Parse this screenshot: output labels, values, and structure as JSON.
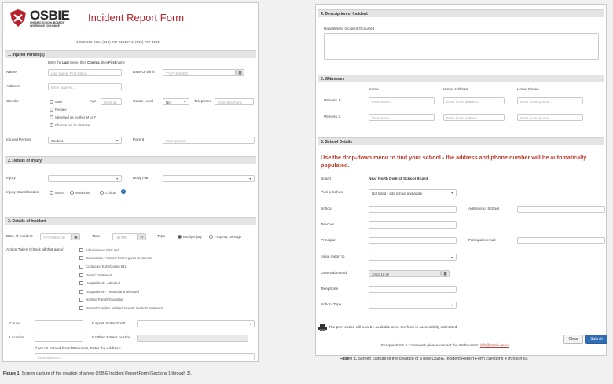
{
  "logo": {
    "name": "OSBIE",
    "line1": "ONTARIO SCHOOL BOARDS'",
    "line2": "INSURANCE EXCHANGE"
  },
  "form_title": "Incident Report Form",
  "contacts": "1-800-668-6724   (519) 767-2182   FAX (519) 767-0281",
  "s1": {
    "title": "1. Injured Person(s)",
    "hint_pre": "Enter the ",
    "hint_last": "Last",
    "hint_mid": " name, then ",
    "hint_comma": "Comma",
    "hint_then": ", then ",
    "hint_first": "First",
    "hint_end": " name",
    "name_label": "Name",
    "name_ph": "Last Name, First Name...",
    "dob_label": "Date Of Birth",
    "dob_ph": "YYYY-MM-DD",
    "address_label": "Address",
    "address_ph": "Enter address...",
    "gender_label": "Gender",
    "gender_options": [
      "Male",
      "Female",
      "Identified as neither M or F",
      "Choose not to disclose"
    ],
    "age_label": "Age",
    "age_ph": "Enter ag",
    "grade_label": "Grade Level",
    "grade_value": "N/A",
    "telephone_label": "Telephone",
    "telephone_ph": "Enter telephone",
    "injured_label": "Injured Person",
    "injured_value": "Student",
    "parent_label": "Parent",
    "parent_ph": "Enter parent..."
  },
  "s2": {
    "title": "2. Details of Injury",
    "injury_label": "Injury",
    "bodypart_label": "Body Part",
    "class_label": "Injury Classification",
    "class_options": [
      "Minor",
      "Moderate",
      "Critical"
    ]
  },
  "s3": {
    "title": "3. Details of Incident",
    "date_label": "Date of Incident",
    "date_ph": "YYYY-MM-DD",
    "time_label": "Time",
    "time_ph": "HH:MM",
    "type_label": "Type",
    "type_options": [
      "Bodily Injury",
      "Property Damage"
    ],
    "action_label": "Action Taken (Check all that apply)",
    "actions": [
      "Administered First Aid",
      "Concussion Protocol Forms given to parents",
      "Contacted EMS/Called 911",
      "Dental Treatment",
      "Hospitalized - Admitted",
      "Hospitalized - Treated and released",
      "Notified Parent/Guardian",
      "Parent/Guardian advised to seek medical treatment"
    ],
    "cause_label": "Cause",
    "sport_label": "If Sport, Enter Sport",
    "location_label": "Location",
    "other_label": "If Other, Enter Location",
    "premises_label": "If not on School board Premises, Enter the Address:",
    "premises_ph": "Enter address..."
  },
  "caption1_bold": "Figure 1.",
  "caption1": " Screen capture of the creation of a new OSBIE Incident Report Form (Sections 1 through 3).",
  "s4": {
    "title": "4. Description of Incident",
    "how_label": "How/Where Incident Occurred"
  },
  "s5": {
    "title": "5. Witnesses",
    "col_name": "Name",
    "col_address": "Home Address",
    "col_phone": "Home Phone",
    "rows": [
      {
        "label": "Witness 1",
        "name_ph": "Enter name...",
        "addr_ph": "Enter home address...",
        "phone_ph": "Enter home phone..."
      },
      {
        "label": "Witness 2",
        "name_ph": "Enter name...",
        "addr_ph": "Enter home address...",
        "phone_ph": "Enter home phone..."
      }
    ]
  },
  "s6": {
    "title": "6. School Details",
    "note": "Use the drop-down menu to find your school - the address and phone number will be automatically populated.",
    "board_label": "Board",
    "board_value": "Near North District School Board",
    "pick_label": "Pick a School",
    "pick_value": "Not listed - add school and addre",
    "school_label": "School",
    "addr_school_label": "Address of School",
    "teacher_label": "Teacher",
    "principal_label": "Principal",
    "principal_email_label": "Principal's email",
    "initial_label": "Initial report to",
    "submitted_label": "Date Submitted",
    "submitted_value": "2018-11-29",
    "telephone_label": "Telephone",
    "type_label": "School Type"
  },
  "print_note": "The print option will now be available once the form is successfully submitted.",
  "clear_label": "Clear",
  "submit_label": "Submit",
  "footer_text": "For questions & comments please contact the Webmaster: ",
  "footer_email": "info@osbie.on.ca",
  "caption2_bold": "Figure 2.",
  "caption2": " Screen capture of the creation of a new OSBIE Incident Report Form (Sections 4 through 6).",
  "colors": {
    "accent": "#b8202a",
    "button": "#2f6db5",
    "link": "#c0392b"
  }
}
